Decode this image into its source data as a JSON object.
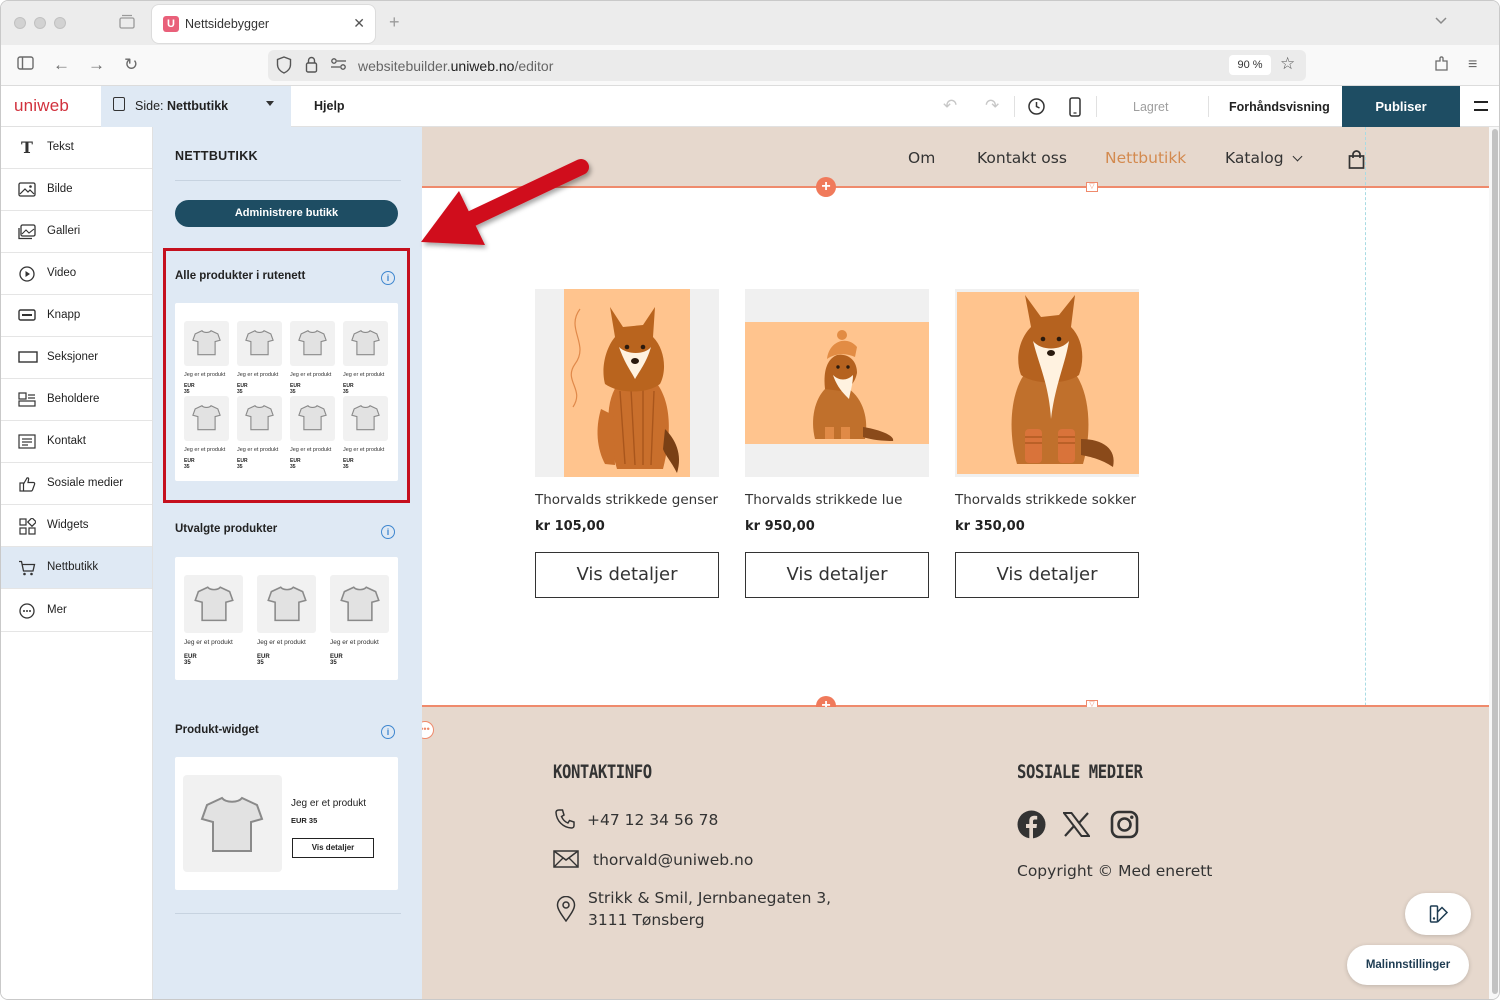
{
  "browser": {
    "tab_title": "Nettsidebygger",
    "favicon_letter": "U",
    "url_prefix": "websitebuilder.",
    "url_domain": "uniweb.no",
    "url_path": "/editor",
    "zoom": "90 %"
  },
  "toolbar": {
    "logo": "uniweb",
    "page_label": "Side:",
    "page_name": "Nettbutikk",
    "help": "Hjelp",
    "saved": "Lagret",
    "preview": "Forhåndsvisning",
    "publish": "Publiser"
  },
  "rail": {
    "items": [
      {
        "label": "Tekst",
        "icon": "text-icon"
      },
      {
        "label": "Bilde",
        "icon": "image-icon"
      },
      {
        "label": "Galleri",
        "icon": "gallery-icon"
      },
      {
        "label": "Video",
        "icon": "video-icon"
      },
      {
        "label": "Knapp",
        "icon": "button-icon"
      },
      {
        "label": "Seksjoner",
        "icon": "sections-icon"
      },
      {
        "label": "Beholdere",
        "icon": "containers-icon"
      },
      {
        "label": "Kontakt",
        "icon": "contact-icon"
      },
      {
        "label": "Sosiale medier",
        "icon": "thumbs-up-icon"
      },
      {
        "label": "Widgets",
        "icon": "widgets-icon"
      },
      {
        "label": "Nettbutikk",
        "icon": "cart-icon"
      },
      {
        "label": "Mer",
        "icon": "more-icon"
      }
    ]
  },
  "panel": {
    "title": "NETTBUTIKK",
    "manage_button": "Administrere butikk",
    "sections": {
      "grid_title": "Alle produkter i rutenett",
      "featured_title": "Utvalgte produkter",
      "widget_title": "Produkt-widget"
    },
    "mini_product_name": "Jeg er et produkt",
    "mini_product_price": "EUR 35",
    "mini_grid_price": "EUR 35",
    "mini_button": "Vis detaljer"
  },
  "site": {
    "nav": {
      "om": "Om",
      "kontakt": "Kontakt oss",
      "nettbutikk": "Nettbutikk",
      "katalog": "Katalog"
    },
    "products": [
      {
        "name": "Thorvalds strikkede genser",
        "price": "kr 105,00",
        "button": "Vis detaljer"
      },
      {
        "name": "Thorvalds strikkede lue",
        "price": "kr 950,00",
        "button": "Vis detaljer"
      },
      {
        "name": "Thorvalds strikkede sokker",
        "price": "kr 350,00",
        "button": "Vis detaljer"
      }
    ],
    "footer": {
      "contact_title": "KONTAKTINFO",
      "phone": "+47 12 34 56 78",
      "email": "thorvald@uniweb.no",
      "address_line1": "Strikk & Smil, Jernbanegaten 3,",
      "address_line2": "3111 Tønsberg",
      "social_title": "SOSIALE MEDIER",
      "copyright": "Copyright © Med enerett"
    }
  },
  "template_settings": "Malinnstillinger",
  "colors": {
    "publish": "#1e4d63",
    "brand_logo": "#d1313d",
    "accent_orange": "#f07a5b",
    "site_beige": "#e6d8cd",
    "active_nav": "#d38a4f",
    "highlight_box": "#c5101d",
    "panel_bg": "#dfe9f4"
  }
}
